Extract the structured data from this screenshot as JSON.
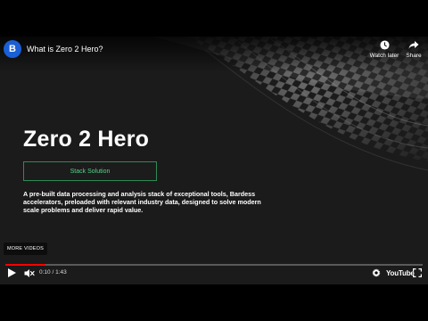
{
  "header": {
    "video_title": "What is Zero 2 Hero?",
    "channel_logo_letter": "B",
    "actions": {
      "watch_later_label": "Watch later",
      "share_label": "Share"
    }
  },
  "slide": {
    "title": "Zero 2 Hero",
    "badge_label": "Stack Solution",
    "description": "A pre-built data processing and analysis stack of exceptional tools, Bardess accelerators, preloaded with relevant industry data, designed to solve modern scale problems and deliver rapid value."
  },
  "overlay": {
    "more_videos_label": "MORE VIDEOS"
  },
  "player": {
    "current_time": "0:10",
    "separator": " / ",
    "duration": "1:43",
    "progress_fraction": 0.097,
    "brand_label": "YouTube",
    "icons": [
      "play-icon",
      "volume-muted-icon",
      "settings-icon",
      "fullscreen-icon",
      "clock-icon",
      "share-icon"
    ]
  },
  "colors": {
    "accent_green": "#53d48a",
    "badge_border": "#2f8a55",
    "progress_red": "#ff0000",
    "channel_blue": "#1a5fd6"
  }
}
